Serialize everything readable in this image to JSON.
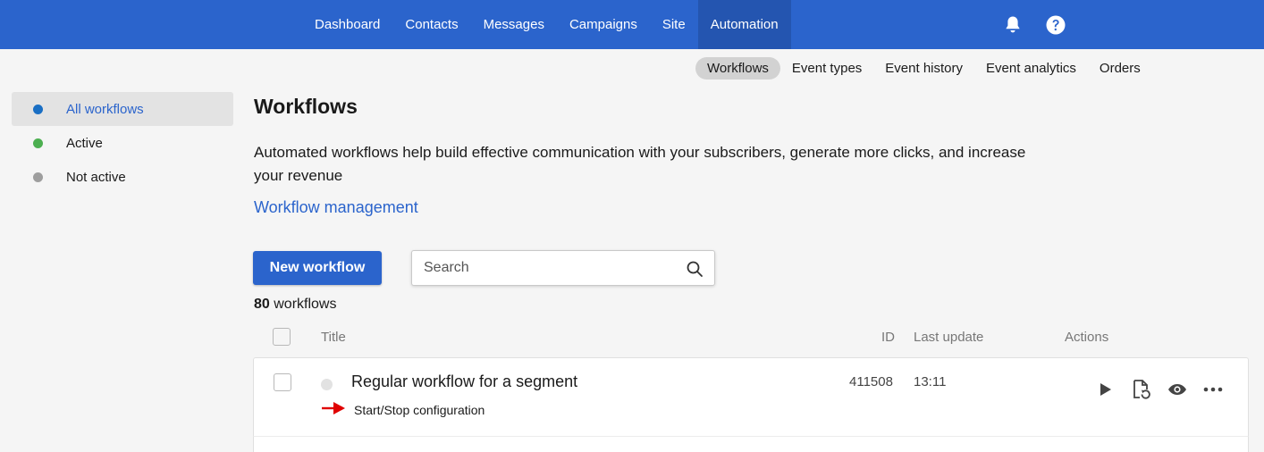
{
  "topnav": {
    "items": [
      {
        "label": "Dashboard"
      },
      {
        "label": "Contacts"
      },
      {
        "label": "Messages"
      },
      {
        "label": "Campaigns"
      },
      {
        "label": "Site"
      },
      {
        "label": "Automation",
        "active": true
      }
    ],
    "icons": [
      "bell-icon",
      "help-icon"
    ]
  },
  "subnav": {
    "items": [
      {
        "label": "Workflows",
        "active": true
      },
      {
        "label": "Event types"
      },
      {
        "label": "Event history"
      },
      {
        "label": "Event analytics"
      },
      {
        "label": "Orders"
      }
    ]
  },
  "sidebar": {
    "items": [
      {
        "label": "All workflows",
        "color": "#1a6fc4",
        "active": true
      },
      {
        "label": "Active",
        "color": "#4caf50"
      },
      {
        "label": "Not active",
        "color": "#9e9e9e"
      }
    ]
  },
  "main": {
    "title": "Workflows",
    "description": "Automated workflows help build effective communication with your subscribers, generate more clicks, and increase your revenue",
    "link": "Workflow management",
    "new_button": "New workflow",
    "search_placeholder": "Search",
    "count_number": "80",
    "count_label": "workflows"
  },
  "table": {
    "columns": {
      "title": "Title",
      "id": "ID",
      "last_update": "Last update",
      "actions": "Actions"
    },
    "rows": [
      {
        "title": "Regular workflow for a segment",
        "subtitle": "Start/Stop configuration",
        "id": "411508",
        "last_update": "13:11",
        "actions": [
          "play-icon",
          "restore-icon",
          "eye-icon",
          "more-icon"
        ]
      }
    ]
  },
  "colors": {
    "brand": "#2b64cc",
    "annotation_arrow": "#e00000"
  }
}
